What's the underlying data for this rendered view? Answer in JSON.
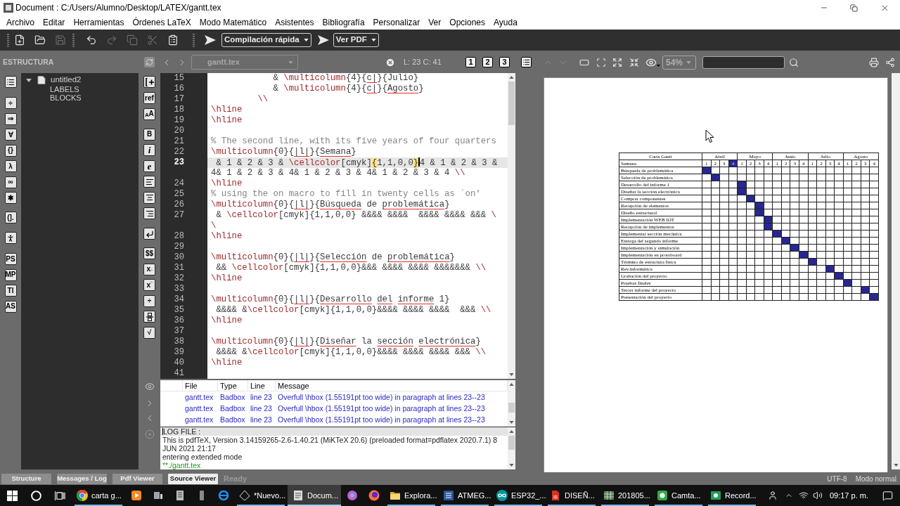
{
  "window": {
    "title": "Document : C:/Users/Alumno/Desktop/LATEX/gantt.tex"
  },
  "menu": [
    "Archivo",
    "Editar",
    "Herramientas",
    "Órdenes LaTeX",
    "Modo Matemático",
    "Asistentes",
    "Bibliografía",
    "Personalizar",
    "Ver",
    "Opciones",
    "Ayuda"
  ],
  "toolbar": {
    "new": {
      "disabled": false
    },
    "open": {
      "disabled": false
    },
    "save": {
      "disabled": true
    },
    "undo": {
      "disabled": false
    },
    "redo": {
      "disabled": true
    },
    "copy": {
      "disabled": true
    },
    "cut": {
      "disabled": true
    },
    "paste": {
      "disabled": false
    },
    "compile": {
      "label": "Compilación rápida"
    },
    "view": {
      "label": "Ver PDF"
    }
  },
  "structure": {
    "title": "ESTRUCTURA",
    "tree": [
      {
        "label": "untitled2",
        "expanded": true,
        "children": [
          {
            "label": "LABELS"
          },
          {
            "label": "BLOCKS"
          }
        ]
      }
    ]
  },
  "symbols_left": [
    [
      {
        "text": "÷",
        "kind": "plain"
      },
      {
        "text": "⇒",
        "kind": "plain"
      },
      {
        "text": "∀",
        "kind": "plain"
      },
      {
        "text": "{}",
        "kind": "plain"
      },
      {
        "text": "λ",
        "kind": "plain"
      },
      {
        "text": "∞",
        "kind": "plain"
      },
      {
        "text": "✱",
        "kind": "plain"
      }
    ],
    [
      {
        "text": "(].",
        "kind": "plain"
      }
    ],
    [
      {
        "text": "PS",
        "kind": "plain"
      },
      {
        "text": "MP",
        "kind": "plain"
      },
      {
        "text": "TI",
        "kind": "plain"
      },
      {
        "text": "AS",
        "kind": "plain"
      }
    ]
  ],
  "symbols_right": [
    [
      {
        "text": "ref",
        "kind": "plain"
      },
      {
        "text": "$_{A}$A",
        "kind": "plain"
      }
    ],
    [
      {
        "text": "B",
        "kind": "plain"
      },
      {
        "text": "i",
        "kind": "italic"
      },
      {
        "text": "e",
        "kind": "italic"
      }
    ],
    [
      {
        "text": "$$",
        "kind": "plain"
      },
      {
        "text": "x$_{▫}$",
        "kind": "plain"
      },
      {
        "text": "x$^{▫}$",
        "kind": "plain"
      },
      {
        "text": "÷",
        "kind": "plain"
      }
    ],
    [
      {
        "text": "√",
        "kind": "plain"
      }
    ]
  ],
  "editor_bar": {
    "file": {
      "value": "gantt.tex",
      "disabled": true
    },
    "position": "L: 23 C: 41",
    "views": [
      "1",
      "2",
      "3"
    ]
  },
  "editor": {
    "rows": [
      {
        "number": "15",
        "current": false,
        "segments": [
          {
            "kind": "text",
            "text": "            & "
          },
          {
            "kind": "command",
            "text": "\\multicolumn"
          },
          {
            "kind": "text",
            "text": "{4}{"
          },
          {
            "kind": "flagged",
            "text": "c|"
          },
          {
            "kind": "text",
            "text": "}{Julio}"
          }
        ]
      },
      {
        "number": "16",
        "current": false,
        "segments": [
          {
            "kind": "text",
            "text": "            & "
          },
          {
            "kind": "command",
            "text": "\\multicolumn"
          },
          {
            "kind": "text",
            "text": "{4}{"
          },
          {
            "kind": "flagged",
            "text": "c|"
          },
          {
            "kind": "text",
            "text": "}{"
          },
          {
            "kind": "flagged",
            "text": "Agosto"
          },
          {
            "kind": "text",
            "text": "}"
          }
        ]
      },
      {
        "number": "17",
        "current": false,
        "segments": [
          {
            "kind": "command",
            "text": "         \\\\"
          }
        ]
      },
      {
        "number": "18",
        "current": false,
        "segments": [
          {
            "kind": "command",
            "text": "\\hline"
          }
        ]
      },
      {
        "number": "19",
        "current": false,
        "segments": [
          {
            "kind": "command",
            "text": "\\hline"
          }
        ]
      },
      {
        "number": "20",
        "current": false
      },
      {
        "number": "21",
        "current": false,
        "segments": [
          {
            "kind": "comment",
            "text": "% The second line, with its five years of four quarters"
          }
        ]
      },
      {
        "number": "22",
        "current": false,
        "segments": [
          {
            "kind": "command",
            "text": "\\multicolumn"
          },
          {
            "kind": "text",
            "text": "{0}{"
          },
          {
            "kind": "flagged",
            "text": "|l|"
          },
          {
            "kind": "text",
            "text": "}{"
          },
          {
            "kind": "flagged",
            "text": "Semana"
          },
          {
            "kind": "text",
            "text": "}"
          }
        ]
      },
      {
        "number": "23",
        "current": true,
        "segments": [
          {
            "kind": "text",
            "text": " & 1 & 2 & 3 & "
          },
          {
            "kind": "command",
            "text": "\\cellcolor"
          },
          {
            "kind": "text",
            "text": "[cmyk]"
          },
          {
            "kind": "match",
            "text": "{"
          },
          {
            "kind": "text",
            "text": "1,1,0,0"
          },
          {
            "kind": "match",
            "text": "}"
          },
          {
            "kind": "caret"
          },
          {
            "kind": "text",
            "text": "4 & 1 & 2 & 3 &"
          }
        ]
      },
      {
        "current": false,
        "segments": [
          {
            "kind": "text",
            "text": "4& 1 & 2 & 3 & 4& 1 & 2 & 3 & 4& 1 & 2 & 3 & 4 "
          },
          {
            "kind": "command",
            "text": "\\\\"
          }
        ]
      },
      {
        "number": "24",
        "current": false,
        "segments": [
          {
            "kind": "command",
            "text": "\\hline"
          }
        ]
      },
      {
        "number": "25",
        "current": false,
        "segments": [
          {
            "kind": "comment",
            "text": "% using the on macro to fill in twenty cells as `on'"
          }
        ]
      },
      {
        "number": "26",
        "current": false,
        "segments": [
          {
            "kind": "command",
            "text": "\\multicolumn"
          },
          {
            "kind": "text",
            "text": "{0}{"
          },
          {
            "kind": "flagged",
            "text": "|l|"
          },
          {
            "kind": "text",
            "text": "}{"
          },
          {
            "kind": "flagged",
            "text": "Búsqueda"
          },
          {
            "kind": "text",
            "text": " de "
          },
          {
            "kind": "flagged",
            "text": "problemática"
          },
          {
            "kind": "text",
            "text": "}"
          }
        ]
      },
      {
        "number": "27",
        "current": false,
        "segments": [
          {
            "kind": "text",
            "text": " & "
          },
          {
            "kind": "command",
            "text": "\\cellcolor"
          },
          {
            "kind": "text",
            "text": "[cmyk]{1,1,0,0} &&&& &&&&  &&&& &&&& &&& "
          },
          {
            "kind": "command",
            "text": "\\"
          }
        ]
      },
      {
        "current": false,
        "segments": [
          {
            "kind": "command",
            "text": "\\"
          }
        ]
      },
      {
        "number": "28",
        "current": false,
        "segments": [
          {
            "kind": "command",
            "text": "\\hline"
          }
        ]
      },
      {
        "number": "29",
        "current": false
      },
      {
        "number": "30",
        "current": false,
        "segments": [
          {
            "kind": "command",
            "text": "\\multicolumn"
          },
          {
            "kind": "text",
            "text": "{0}{"
          },
          {
            "kind": "flagged",
            "text": "|l|"
          },
          {
            "kind": "text",
            "text": "}{"
          },
          {
            "kind": "flagged",
            "text": "Selección"
          },
          {
            "kind": "text",
            "text": " de "
          },
          {
            "kind": "flagged",
            "text": "problemática"
          },
          {
            "kind": "text",
            "text": "}"
          }
        ]
      },
      {
        "number": "31",
        "current": false,
        "segments": [
          {
            "kind": "text",
            "text": " && "
          },
          {
            "kind": "command",
            "text": "\\cellcolor"
          },
          {
            "kind": "text",
            "text": "[cmyk]{1,1,0,0}&&& &&&& &&&& &&&&&&& "
          },
          {
            "kind": "command",
            "text": "\\\\"
          }
        ]
      },
      {
        "number": "32",
        "current": false,
        "segments": [
          {
            "kind": "command",
            "text": "\\hline"
          }
        ]
      },
      {
        "number": "33",
        "current": false
      },
      {
        "number": "34",
        "current": false,
        "segments": [
          {
            "kind": "command",
            "text": "\\multicolumn"
          },
          {
            "kind": "text",
            "text": "{0}{"
          },
          {
            "kind": "flagged",
            "text": "|l|"
          },
          {
            "kind": "text",
            "text": "}{"
          },
          {
            "kind": "flagged",
            "text": "Desarrollo"
          },
          {
            "kind": "space"
          },
          {
            "kind": "flagged",
            "text": "del"
          },
          {
            "kind": "space"
          },
          {
            "kind": "flagged",
            "text": "informe"
          },
          {
            "kind": "text",
            "text": " 1}"
          }
        ]
      },
      {
        "number": "35",
        "current": false,
        "segments": [
          {
            "kind": "text",
            "text": " &&&& &"
          },
          {
            "kind": "command",
            "text": "\\cellcolor"
          },
          {
            "kind": "text",
            "text": "[cmyk]{1,1,0,0}&&&& &&&& &&&&  &&& "
          },
          {
            "kind": "command",
            "text": "\\\\"
          }
        ]
      },
      {
        "number": "36",
        "current": false,
        "segments": [
          {
            "kind": "command",
            "text": "\\hline"
          }
        ]
      },
      {
        "number": "37",
        "current": false
      },
      {
        "number": "38",
        "current": false,
        "segments": [
          {
            "kind": "command",
            "text": "\\multicolumn"
          },
          {
            "kind": "text",
            "text": "{0}{"
          },
          {
            "kind": "flagged",
            "text": "|l|"
          },
          {
            "kind": "text",
            "text": "}{"
          },
          {
            "kind": "flagged",
            "text": "Diseñar"
          },
          {
            "kind": "text",
            "text": " la "
          },
          {
            "kind": "flagged",
            "text": "sección"
          },
          {
            "kind": "space"
          },
          {
            "kind": "flagged",
            "text": "electrónica"
          },
          {
            "kind": "text",
            "text": "}"
          }
        ]
      },
      {
        "number": "39",
        "current": false,
        "segments": [
          {
            "kind": "text",
            "text": " &&&& &"
          },
          {
            "kind": "command",
            "text": "\\cellcolor"
          },
          {
            "kind": "text",
            "text": "[cmyk]{1,1,0,0}&&&& &&&& &&&& &&& "
          },
          {
            "kind": "command",
            "text": "\\\\"
          }
        ]
      },
      {
        "number": "40",
        "current": false,
        "segments": [
          {
            "kind": "command",
            "text": "\\hline"
          }
        ]
      },
      {
        "number": "41",
        "current": false
      }
    ]
  },
  "messages": {
    "columns": [
      "File",
      "Type",
      "Line",
      "Message"
    ],
    "rows": [
      {
        "file": "gantt.tex",
        "type": "Badbox",
        "line": "line 23",
        "message": "Overfull \\hbox (1.55191pt too wide) in paragraph at lines 23--23"
      },
      {
        "file": "gantt.tex",
        "type": "Badbox",
        "line": "line 23",
        "message": "Overfull \\hbox (1.55191pt too wide) in paragraph at lines 23--23"
      },
      {
        "file": "gantt.tex",
        "type": "Badbox",
        "line": "line 23",
        "message": "Overfull \\hbox (1.55191pt too wide) in paragraph at lines 23--23"
      }
    ]
  },
  "log": {
    "lines": [
      {
        "text": "LOG FILE :",
        "kind": "plain",
        "current": true
      },
      {
        "text": "This is pdfTeX, Version 3.14159265-2.6-1.40.21 (MiKTeX 20.6) (preloaded format=pdflatex 2020.7.1) 8 JUN 2021 21:17",
        "kind": "plain",
        "current": false
      },
      {
        "text": "entering extended mode",
        "kind": "plain",
        "current": false
      },
      {
        "text": "**./gantt.tex",
        "kind": "input",
        "current": false
      }
    ]
  },
  "pdf_toolbar": {
    "previous": {
      "disabled": true
    },
    "next": {
      "disabled": true
    },
    "zoom": "54%"
  },
  "pdf": {
    "table": {
      "title": "Carta Gantt",
      "months": [
        "Abril",
        "Mayo",
        "Junio",
        "Julio",
        "Agosto"
      ],
      "weeks_label": "Semana",
      "weeks": [
        {
          "label": "1",
          "filled": false
        },
        {
          "label": "2",
          "filled": false
        },
        {
          "label": "3",
          "filled": false
        },
        {
          "label": "4",
          "filled": true
        },
        {
          "label": "1",
          "filled": false
        },
        {
          "label": "2",
          "filled": false
        },
        {
          "label": "3",
          "filled": false
        },
        {
          "label": "4",
          "filled": false
        },
        {
          "label": "1",
          "filled": false
        },
        {
          "label": "2",
          "filled": false
        },
        {
          "label": "3",
          "filled": false
        },
        {
          "label": "4",
          "filled": false
        },
        {
          "label": "1",
          "filled": false
        },
        {
          "label": "2",
          "filled": false
        },
        {
          "label": "3",
          "filled": false
        },
        {
          "label": "4",
          "filled": false
        },
        {
          "label": "1",
          "filled": false
        },
        {
          "label": "2",
          "filled": false
        },
        {
          "label": "3",
          "filled": false
        },
        {
          "label": "4",
          "filled": false
        }
      ],
      "rows": [
        {
          "task": "Búsqueda de problemática",
          "filled": [
            true,
            false,
            false,
            false,
            false,
            false,
            false,
            false,
            false,
            false,
            false,
            false,
            false,
            false,
            false,
            false,
            false,
            false,
            false,
            false
          ]
        },
        {
          "task": "Selección de problemática",
          "filled": [
            false,
            true,
            false,
            false,
            false,
            false,
            false,
            false,
            false,
            false,
            false,
            false,
            false,
            false,
            false,
            false,
            false,
            false,
            false,
            false
          ]
        },
        {
          "task": "Desarrollo del informe 1",
          "filled": [
            false,
            false,
            false,
            false,
            true,
            false,
            false,
            false,
            false,
            false,
            false,
            false,
            false,
            false,
            false,
            false,
            false,
            false,
            false,
            false
          ]
        },
        {
          "task": "Diseñar la sección electrónica",
          "filled": [
            false,
            false,
            false,
            false,
            true,
            false,
            false,
            false,
            false,
            false,
            false,
            false,
            false,
            false,
            false,
            false,
            false,
            false,
            false,
            false
          ]
        },
        {
          "task": "Comprar componentes",
          "filled": [
            false,
            false,
            false,
            false,
            false,
            true,
            false,
            false,
            false,
            false,
            false,
            false,
            false,
            false,
            false,
            false,
            false,
            false,
            false,
            false
          ]
        },
        {
          "task": "Recepción de elementos",
          "filled": [
            false,
            false,
            false,
            false,
            false,
            false,
            true,
            false,
            false,
            false,
            false,
            false,
            false,
            false,
            false,
            false,
            false,
            false,
            false,
            false
          ]
        },
        {
          "task": "Diseño estructural",
          "filled": [
            false,
            false,
            false,
            false,
            false,
            false,
            true,
            false,
            false,
            false,
            false,
            false,
            false,
            false,
            false,
            false,
            false,
            false,
            false,
            false
          ]
        },
        {
          "task": "Implementación WEB IOT",
          "filled": [
            false,
            false,
            false,
            false,
            false,
            false,
            false,
            true,
            false,
            false,
            false,
            false,
            false,
            false,
            false,
            false,
            false,
            false,
            false,
            false
          ]
        },
        {
          "task": "Recepción de implementos",
          "filled": [
            false,
            false,
            false,
            false,
            false,
            false,
            false,
            true,
            false,
            false,
            false,
            false,
            false,
            false,
            false,
            false,
            false,
            false,
            false,
            false
          ]
        },
        {
          "task": "Implementar sección mecánica",
          "filled": [
            false,
            false,
            false,
            false,
            false,
            false,
            false,
            false,
            true,
            false,
            false,
            false,
            false,
            false,
            false,
            false,
            false,
            false,
            false,
            false
          ]
        },
        {
          "task": "Entrega del segundo informe",
          "filled": [
            false,
            false,
            false,
            false,
            false,
            false,
            false,
            false,
            false,
            true,
            false,
            false,
            false,
            false,
            false,
            false,
            false,
            false,
            false,
            false
          ]
        },
        {
          "task": "Implementación y simulación",
          "filled": [
            false,
            false,
            false,
            false,
            false,
            false,
            false,
            false,
            false,
            false,
            true,
            false,
            false,
            false,
            false,
            false,
            false,
            false,
            false,
            false
          ]
        },
        {
          "task": "Implementación en protoboard",
          "filled": [
            false,
            false,
            false,
            false,
            false,
            false,
            false,
            false,
            false,
            false,
            false,
            true,
            false,
            false,
            false,
            false,
            false,
            false,
            false,
            false
          ]
        },
        {
          "task": "Término de estructura física",
          "filled": [
            false,
            false,
            false,
            false,
            false,
            false,
            false,
            false,
            false,
            false,
            false,
            false,
            true,
            false,
            false,
            false,
            false,
            false,
            false,
            false
          ]
        },
        {
          "task": "Rev.informática",
          "filled": [
            false,
            false,
            false,
            false,
            false,
            false,
            false,
            false,
            false,
            false,
            false,
            false,
            false,
            false,
            true,
            false,
            false,
            false,
            false,
            false
          ]
        },
        {
          "task": "Grabación del proyecto",
          "filled": [
            false,
            false,
            false,
            false,
            false,
            false,
            false,
            false,
            false,
            false,
            false,
            false,
            false,
            false,
            false,
            true,
            false,
            false,
            false,
            false
          ]
        },
        {
          "task": "Pruebas finales",
          "filled": [
            false,
            false,
            false,
            false,
            false,
            false,
            false,
            false,
            false,
            false,
            false,
            false,
            false,
            false,
            false,
            false,
            true,
            false,
            false,
            false
          ]
        },
        {
          "task": "Tercer informe del proyecto",
          "filled": [
            false,
            false,
            false,
            false,
            false,
            false,
            false,
            false,
            false,
            false,
            false,
            false,
            false,
            false,
            false,
            false,
            false,
            false,
            true,
            false
          ]
        },
        {
          "task": "Presentación del proyecto",
          "filled": [
            false,
            false,
            false,
            false,
            false,
            false,
            false,
            false,
            false,
            false,
            false,
            false,
            false,
            false,
            false,
            false,
            false,
            false,
            false,
            true
          ]
        }
      ]
    }
  },
  "panels": [
    {
      "label": "Structure",
      "selected": false
    },
    {
      "label": "Messages / Log",
      "selected": false
    },
    {
      "label": "Pdf Viewer",
      "selected": false
    },
    {
      "label": "Source Viewer",
      "selected": true
    }
  ],
  "status": "Ready",
  "encoding": "UTF-8",
  "mode": "Modo normal",
  "taskbar": {
    "apps": [
      {
        "label": "carta g...",
        "selected": false
      },
      {
        "label": "*Nuevo...",
        "selected": false
      },
      {
        "label": "Docum...",
        "selected": true
      },
      {
        "label": "Explora...",
        "selected": false
      },
      {
        "label": "ATMEG...",
        "selected": false
      },
      {
        "label": "ESP32_...",
        "selected": false
      },
      {
        "label": "DISEÑ...",
        "selected": false
      },
      {
        "label": "201805...",
        "selected": false
      },
      {
        "label": "Camta...",
        "selected": false
      },
      {
        "label": "Record...",
        "selected": false
      }
    ],
    "clock": "09:17 p. m."
  }
}
